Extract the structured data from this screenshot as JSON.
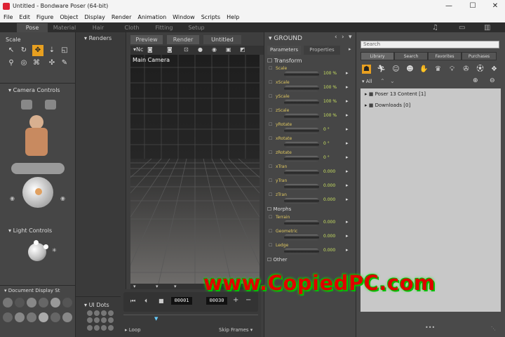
{
  "window": {
    "title": "Untitled - Bondware Poser (64-bit)",
    "minimize": "—",
    "maximize": "☐",
    "close": "✕"
  },
  "menu": [
    "File",
    "Edit",
    "Figure",
    "Object",
    "Display",
    "Render",
    "Animation",
    "Window",
    "Scripts",
    "Help"
  ],
  "rooms": [
    "Pose",
    "Material",
    "Hair",
    "Cloth",
    "Fitting",
    "Setup"
  ],
  "active_room": "Pose",
  "left": {
    "scale_label": "Scale",
    "camera_controls": "Camera Controls",
    "light_controls": "Light Controls",
    "document_display": "Document Display St"
  },
  "renders_label": "Renders",
  "ui_dots_label": "UI Dots",
  "doc_tabs": [
    "Preview",
    "Render",
    "Untitled"
  ],
  "active_doc_tab": "Untitled",
  "viewport": {
    "camera_label": "Main Camera",
    "doc_selector": "Nc"
  },
  "timeline": {
    "frame": "00001",
    "end_frame": "00030",
    "loop": "Loop",
    "skip_frames": "Skip Frames",
    "plus": "+",
    "minus": "−"
  },
  "params": {
    "actor": "GROUND",
    "tabs": [
      "Parameters",
      "Properties"
    ],
    "groups": {
      "transform": "Transform",
      "morphs": "Morphs",
      "other": "Other"
    },
    "transform": [
      {
        "name": "Scale",
        "value": "100 %"
      },
      {
        "name": "xScale",
        "value": "100 %"
      },
      {
        "name": "yScale",
        "value": "100 %"
      },
      {
        "name": "zScale",
        "value": "100 %"
      },
      {
        "name": "yRotate",
        "value": "0 °"
      },
      {
        "name": "xRotate",
        "value": "0 °"
      },
      {
        "name": "zRotate",
        "value": "0 °"
      },
      {
        "name": "xTran",
        "value": "0.000"
      },
      {
        "name": "yTran",
        "value": "0.000"
      },
      {
        "name": "zTran",
        "value": "0.000"
      }
    ],
    "morphs": [
      {
        "name": "Terrain",
        "value": "0.000"
      },
      {
        "name": "Geometric",
        "value": "0.000"
      },
      {
        "name": "Ledge",
        "value": "0.000"
      }
    ]
  },
  "library": {
    "search_placeholder": "Search",
    "tabs": [
      "Library",
      "Search",
      "Favorites",
      "Purchases"
    ],
    "filter": "All",
    "items": [
      {
        "label": "Poser 13 Content",
        "count": "[1]"
      },
      {
        "label": "Downloads",
        "count": "[0]"
      }
    ]
  },
  "watermark": "www.CopiedPC.com",
  "colors": {
    "accent": "#e8a020",
    "slider_value": "#c8e060",
    "slider_label": "#e0c860",
    "watermark": "#e00000"
  }
}
